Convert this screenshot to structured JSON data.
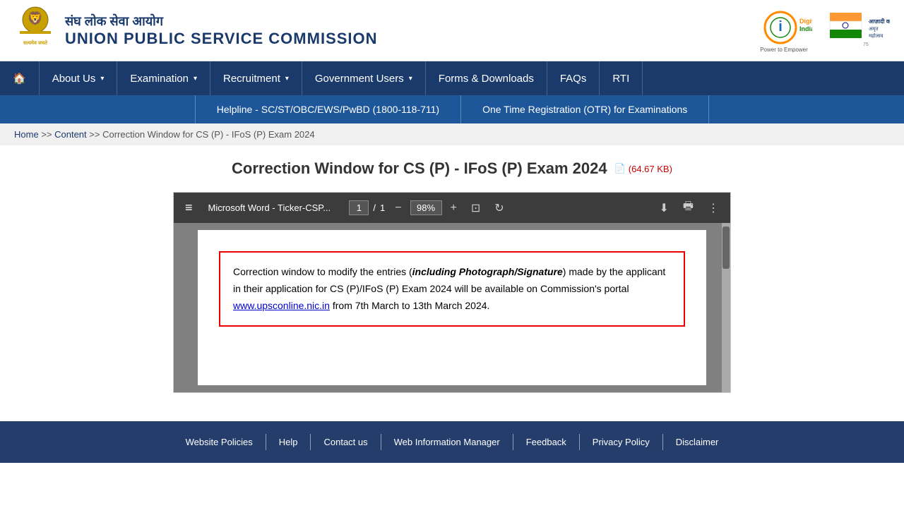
{
  "site": {
    "emblem_alt": "Emblem of India",
    "org_hindi": "संघ लोक सेवा आयोग",
    "org_english": "UNION PUBLIC SERVICE COMMISSION",
    "digital_india_text": "Digital India",
    "digital_india_subtext": "Power to Empower",
    "azadi_text": "आज़ादी का",
    "azadi_subtext": "अमृत महोत्सव"
  },
  "nav": {
    "home_label": "🏠",
    "items": [
      {
        "label": "About Us",
        "has_dropdown": true
      },
      {
        "label": "Examination",
        "has_dropdown": true
      },
      {
        "label": "Recruitment",
        "has_dropdown": true
      },
      {
        "label": "Government Users",
        "has_dropdown": true
      },
      {
        "label": "Forms & Downloads",
        "has_dropdown": false
      },
      {
        "label": "FAQs",
        "has_dropdown": false
      },
      {
        "label": "RTI",
        "has_dropdown": false
      }
    ]
  },
  "sub_nav": {
    "items": [
      {
        "label": "Helpline - SC/ST/OBC/EWS/PwBD (1800-118-711)"
      },
      {
        "label": "One Time Registration (OTR) for Examinations"
      }
    ]
  },
  "breadcrumb": {
    "home": "Home",
    "separator": " >> ",
    "content": "Content",
    "separator2": " >> ",
    "current": "Correction Window for CS (P) - IFoS (P) Exam 2024"
  },
  "page": {
    "title": "Correction Window for CS (P) - IFoS (P) Exam 2024",
    "file_icon": "📄",
    "file_size": "(64.67 KB)"
  },
  "pdf_viewer": {
    "toolbar": {
      "hamburger": "≡",
      "doc_title": "Microsoft Word - Ticker-CSP...",
      "page_current": "1",
      "page_sep": "/",
      "page_total": "1",
      "zoom_out": "−",
      "zoom_level": "98%",
      "zoom_in": "+",
      "fit_page": "⊡",
      "rotate": "↻",
      "download": "⬇",
      "print": "🖶",
      "more": "⋮"
    },
    "content": {
      "line1_pre": "Correction window to modify the entries (",
      "line1_bold": "including Photograph/Signature",
      "line1_post": ") made by the applicant in their application for CS (P)/IFoS (P)  Exam 2024 will be available on Commission's portal ",
      "link_text": "www.upsconline.nic.in",
      "link_href": "http://www.upsconline.nic.in",
      "line2": " from 7th March to 13th March 2024."
    }
  },
  "footer": {
    "links": [
      {
        "label": "Website Policies"
      },
      {
        "label": "Help"
      },
      {
        "label": "Contact us"
      },
      {
        "label": "Web Information Manager"
      },
      {
        "label": "Feedback"
      },
      {
        "label": "Privacy Policy"
      },
      {
        "label": "Disclaimer"
      }
    ]
  }
}
